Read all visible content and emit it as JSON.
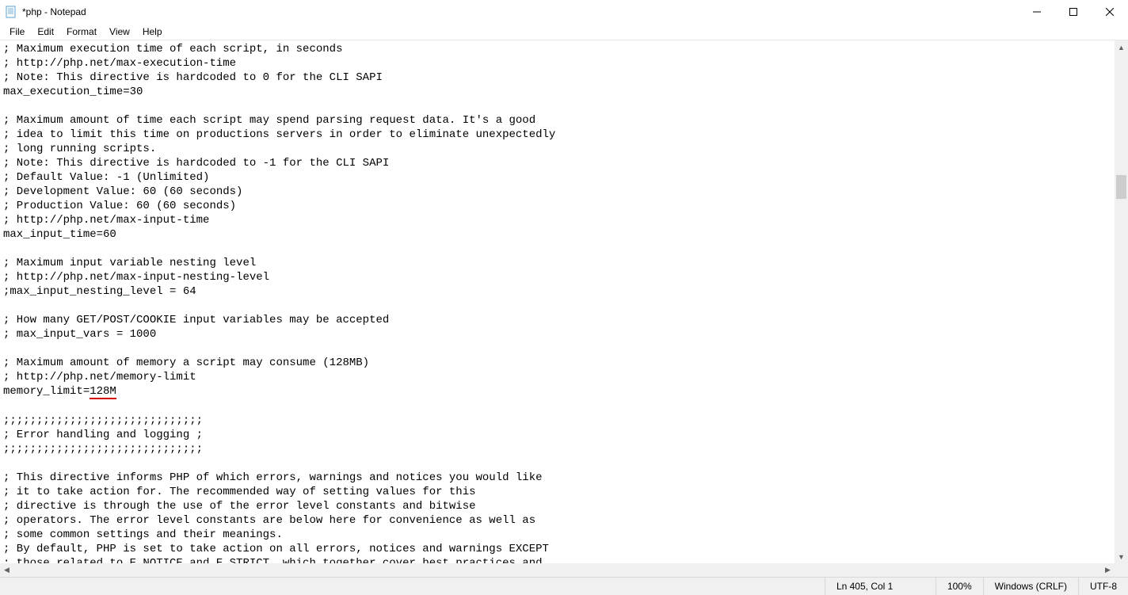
{
  "titlebar": {
    "title": "*php - Notepad"
  },
  "menubar": {
    "items": [
      "File",
      "Edit",
      "Format",
      "View",
      "Help"
    ]
  },
  "editor": {
    "lines": [
      "; Maximum execution time of each script, in seconds",
      "; http://php.net/max-execution-time",
      "; Note: This directive is hardcoded to 0 for the CLI SAPI",
      "max_execution_time=30",
      "",
      "; Maximum amount of time each script may spend parsing request data. It's a good",
      "; idea to limit this time on productions servers in order to eliminate unexpectedly",
      "; long running scripts.",
      "; Note: This directive is hardcoded to -1 for the CLI SAPI",
      "; Default Value: -1 (Unlimited)",
      "; Development Value: 60 (60 seconds)",
      "; Production Value: 60 (60 seconds)",
      "; http://php.net/max-input-time",
      "max_input_time=60",
      "",
      "; Maximum input variable nesting level",
      "; http://php.net/max-input-nesting-level",
      ";max_input_nesting_level = 64",
      "",
      "; How many GET/POST/COOKIE input variables may be accepted",
      "; max_input_vars = 1000",
      "",
      "; Maximum amount of memory a script may consume (128MB)",
      "; http://php.net/memory-limit",
      [
        "memory_limit=",
        "128M"
      ],
      "",
      ";;;;;;;;;;;;;;;;;;;;;;;;;;;;;;",
      "; Error handling and logging ;",
      ";;;;;;;;;;;;;;;;;;;;;;;;;;;;;;",
      "",
      "; This directive informs PHP of which errors, warnings and notices you would like",
      "; it to take action for. The recommended way of setting values for this",
      "; directive is through the use of the error level constants and bitwise",
      "; operators. The error level constants are below here for convenience as well as",
      "; some common settings and their meanings.",
      "; By default, PHP is set to take action on all errors, notices and warnings EXCEPT",
      "; those related to E_NOTICE and E_STRICT, which together cover best practices and"
    ]
  },
  "statusbar": {
    "position": "Ln 405, Col 1",
    "zoom": "100%",
    "lineending": "Windows (CRLF)",
    "encoding": "UTF-8"
  }
}
